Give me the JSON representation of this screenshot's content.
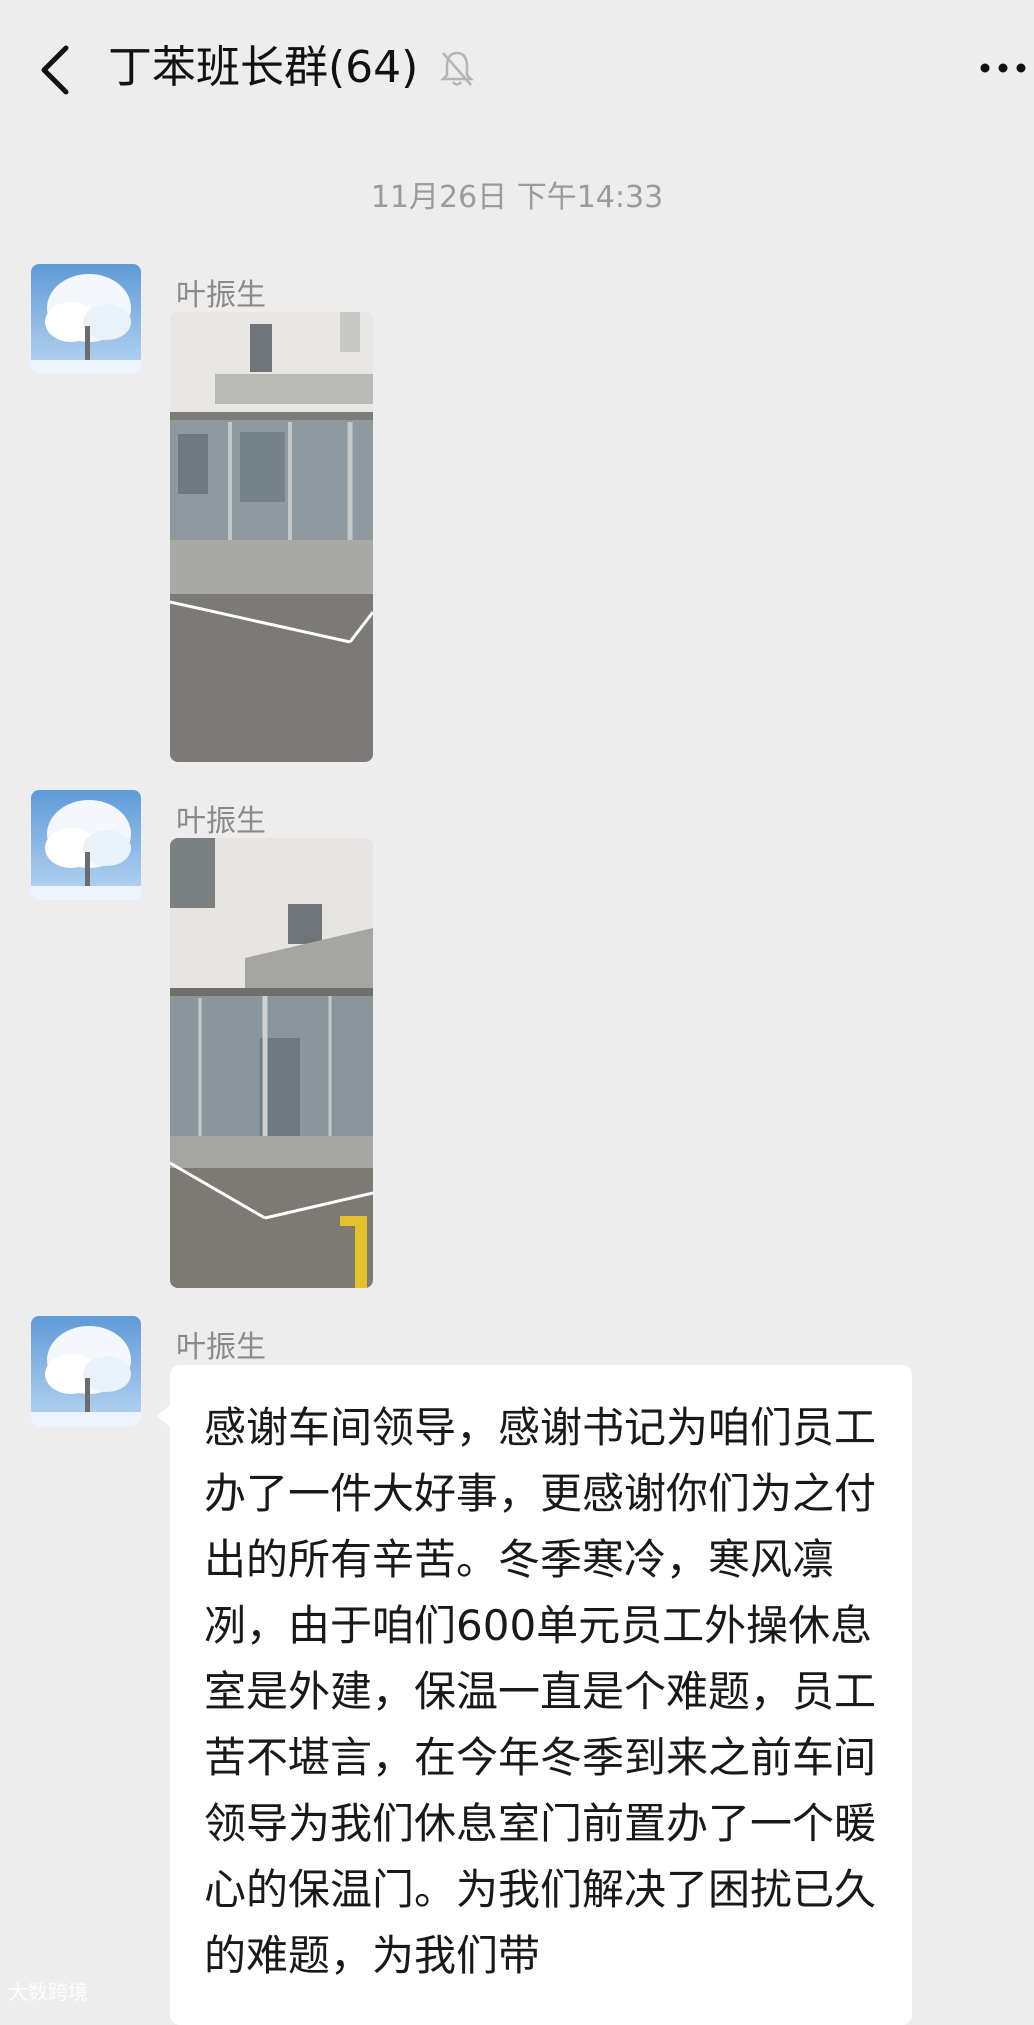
{
  "header": {
    "title": "丁苯班长群(64)",
    "icons": [
      "back-icon",
      "mute-bell-icon",
      "more-icon"
    ]
  },
  "chat": {
    "timestamp": "11月26日 下午14:33",
    "messages": [
      {
        "sender": "叶振生",
        "type": "image"
      },
      {
        "sender": "叶振生",
        "type": "image"
      },
      {
        "sender": "叶振生",
        "type": "text",
        "text": "感谢车间领导，感谢书记为咱们员工办了一件大好事，更感谢你们为之付出的所有辛苦。冬季寒冷，寒风凛冽，由于咱们600单元员工外操休息室是外建，保温一直是个难题，员工苦不堪言，在今年冬季到来之前车间领导为我们休息室门前置办了一个暖心的保温门。为我们解决了困扰已久的难题，为我们带"
      }
    ]
  },
  "watermark": "大数跨境",
  "colors": {
    "background": "#ededed",
    "bubble": "#ffffff",
    "timestamp": "#9b9b9b",
    "sender": "#8a8a8a"
  }
}
